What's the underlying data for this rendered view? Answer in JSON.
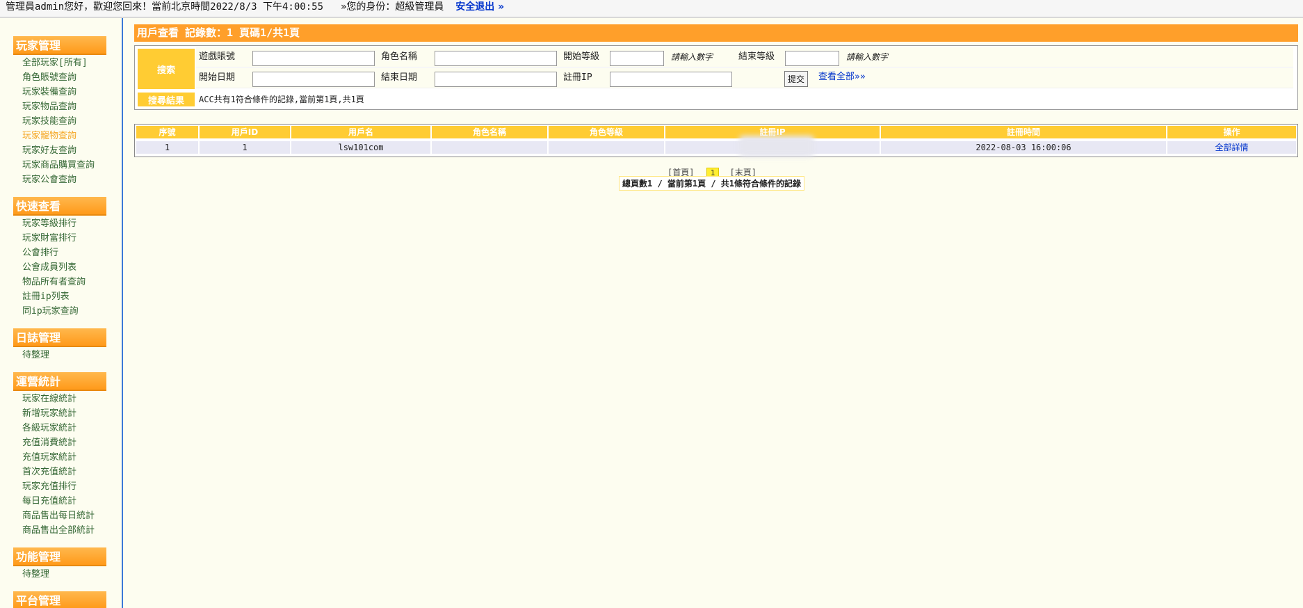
{
  "topbar": {
    "greeting": "管理員admin您好，歡迎您回來！當前北京時間2022/8/3 下午4:00:55",
    "role": "»您的身份：超級管理員",
    "logout": "安全退出 »"
  },
  "sidebar": {
    "sections": [
      {
        "title": "玩家管理",
        "items": [
          "全部玩家[所有]",
          "角色賬號查詢",
          "玩家裝備查詢",
          "玩家物品查詢",
          "玩家技能查詢",
          "玩家寵物查詢",
          "玩家好友查詢",
          "玩家商品購買查詢",
          "玩家公會查詢"
        ]
      },
      {
        "title": "快速查看",
        "items": [
          "玩家等級排行",
          "玩家財富排行",
          "公會排行",
          "公會成員列表",
          "物品所有者查詢",
          "註冊ip列表",
          "同ip玩家查詢"
        ]
      },
      {
        "title": "日誌管理",
        "items": [
          "待整理"
        ]
      },
      {
        "title": "運營統計",
        "items": [
          "玩家在線統計",
          "新增玩家統計",
          "各級玩家統計",
          "充值消費統計",
          "充值玩家統計",
          "首次充值統計",
          "玩家充值排行",
          "每日充值統計",
          "商品售出每日統計",
          "商品售出全部統計"
        ]
      },
      {
        "title": "功能管理",
        "items": [
          "待整理"
        ]
      },
      {
        "title": "平台管理",
        "items": []
      }
    ]
  },
  "main": {
    "title": "用戶查看 記錄數：1 頁碼1/共1頁",
    "search": {
      "label": "搜索",
      "fields": {
        "account_label": "遊戲賬號",
        "role_name_label": "角色名稱",
        "start_level_label": "開始等級",
        "start_level_hint": "請輸入數字",
        "end_level_label": "結束等級",
        "end_level_hint": "請輸入數字",
        "start_date_label": "開始日期",
        "end_date_label": "結束日期",
        "reg_ip_label": "註冊IP"
      },
      "submit": "提交",
      "view_all": "查看全部»»"
    },
    "result": {
      "label": "搜尋結果",
      "text": "ACC共有1符合條件的記錄,當前第1頁,共1頁"
    },
    "table": {
      "headers": [
        "序號",
        "用戶ID",
        "用戶名",
        "角色名稱",
        "角色等級",
        "註冊IP",
        "註冊時間",
        "操作"
      ],
      "rows": [
        {
          "index": "1",
          "user_id": "1",
          "username": "lsw101com",
          "role_name": "",
          "role_level": "",
          "reg_ip": "",
          "reg_time": "2022-08-03 16:00:06",
          "action": "全部詳情"
        }
      ]
    },
    "pager": {
      "first": "[首頁]",
      "current": "1",
      "last": "[末頁]",
      "summary": "總頁數1 / 當前第1頁 / 共1條符合條件的記錄"
    }
  }
}
